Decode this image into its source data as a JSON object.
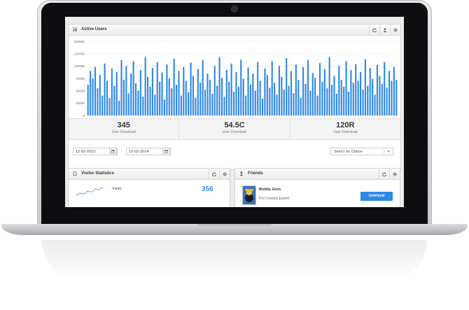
{
  "header": {
    "title": "Active Users"
  },
  "chart_data": {
    "type": "bar",
    "title": "",
    "xlabel": "",
    "ylabel": "",
    "ylim": [
      0,
      150000
    ],
    "yticks": [
      "0",
      "25000",
      "50000",
      "75000",
      "100000",
      "125000",
      "150000"
    ],
    "values": [
      62000,
      90000,
      75000,
      98000,
      55000,
      82000,
      40000,
      105000,
      70000,
      35000,
      95000,
      60000,
      88000,
      30000,
      112000,
      72000,
      100000,
      45000,
      85000,
      110000,
      65000,
      50000,
      92000,
      38000,
      118000,
      78000,
      58000,
      96000,
      42000,
      108000,
      68000,
      87000,
      32000,
      103000,
      75000,
      55000,
      115000,
      62000,
      90000,
      40000,
      98000,
      70000,
      47000,
      107000,
      80000,
      36000,
      94000,
      66000,
      112000,
      52000,
      85000,
      72000,
      44000,
      100000,
      60000,
      118000,
      76000,
      38000,
      92000,
      68000,
      105000,
      48000,
      88000,
      58000,
      113000,
      74000,
      40000,
      97000,
      63000,
      85000,
      50000,
      108000,
      70000,
      34000,
      95000,
      82000,
      56000,
      110000,
      66000,
      42000,
      100000,
      78000,
      52000,
      116000,
      60000,
      90000,
      45000,
      103000,
      72000,
      36000,
      98000,
      64000,
      112000,
      50000,
      86000,
      76000,
      40000,
      106000,
      68000,
      94000,
      55000,
      118000,
      62000,
      80000,
      44000,
      100000,
      72000,
      58000,
      110000,
      48000,
      92000,
      66000,
      104000,
      70000,
      88000,
      52000,
      114000,
      60000,
      96000,
      74000,
      42000,
      102000,
      80000,
      64000,
      108000,
      56000,
      90000,
      70000,
      98000,
      72000
    ],
    "color": "#2f88e4"
  },
  "stats": [
    {
      "value": "345",
      "label": "User Download"
    },
    {
      "value": "54.5C",
      "label": "User Download"
    },
    {
      "value": "120R",
      "label": "User Download"
    }
  ],
  "filters": {
    "date_from": "12-02-2013",
    "date_to": "12-02-2014",
    "separator": "-",
    "select_placeholder": "Select an Option"
  },
  "visitor": {
    "title": "Visitor Statistics",
    "label": "Visits:",
    "value": "356",
    "sparkline": [
      4,
      6,
      5,
      8,
      7,
      10,
      9,
      12
    ]
  },
  "friends": {
    "title": "Friends",
    "name": "Bobby Ginn",
    "role": "Pro Cookies Eanter",
    "button_label": "Unfriend"
  },
  "icons": {
    "chart": "bar-chart-icon",
    "refresh": "refresh-icon",
    "user": "user-icon",
    "gear": "gear-icon",
    "calendar": "calendar-icon",
    "document": "document-icon",
    "people": "people-icon"
  },
  "colors": {
    "accent": "#2d89e5",
    "value_blue": "#3c8dde"
  }
}
